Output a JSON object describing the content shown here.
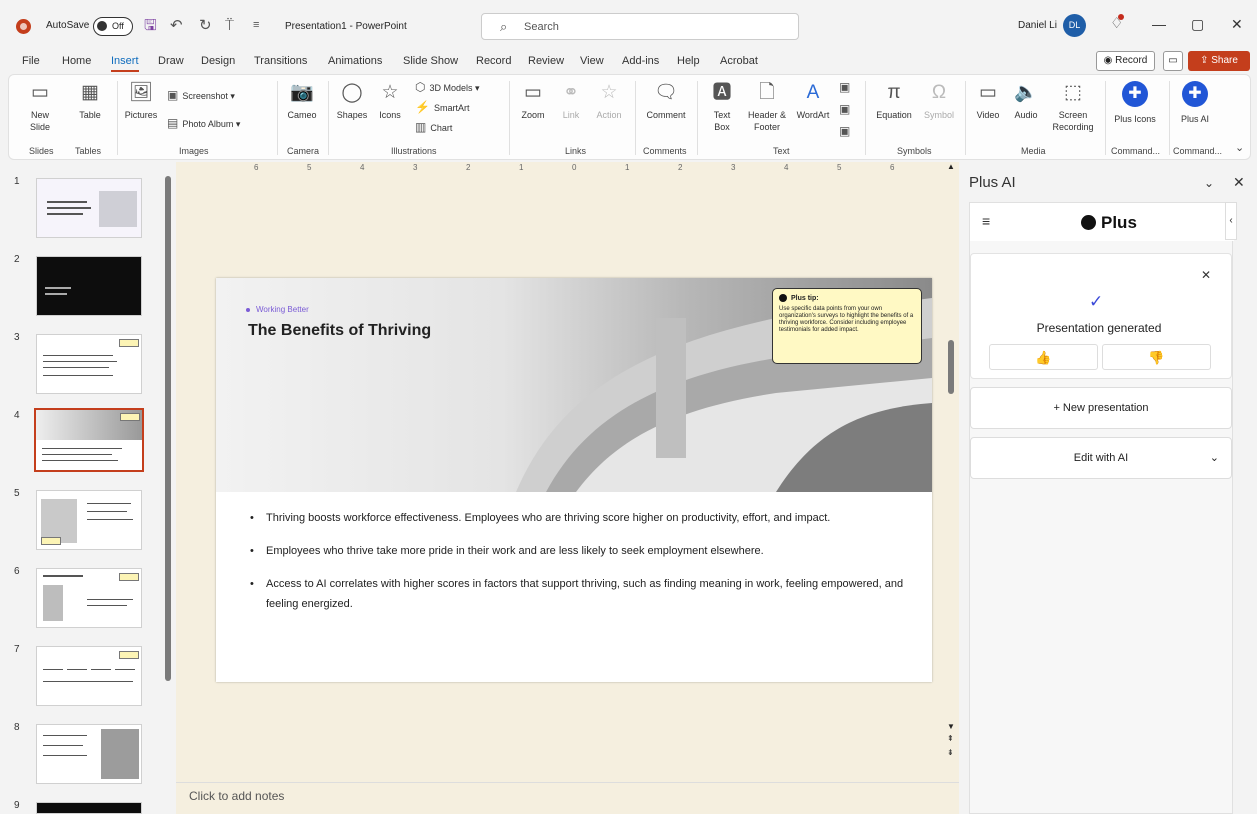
{
  "titlebar": {
    "autosave_label": "AutoSave",
    "autosave_state": "Off",
    "doc_title": "Presentation1 - PowerPoint",
    "search_placeholder": "Search",
    "user_name": "Daniel Li",
    "user_initials": "DL"
  },
  "menu": {
    "tabs": [
      "File",
      "Home",
      "Insert",
      "Draw",
      "Design",
      "Transitions",
      "Animations",
      "Slide Show",
      "Record",
      "Review",
      "View",
      "Add-ins",
      "Help",
      "Acrobat"
    ],
    "active_tab": "Insert",
    "record_label": "Record",
    "share_label": "Share"
  },
  "ribbon": {
    "new_slide": "New Slide",
    "table": "Table",
    "pictures": "Pictures",
    "screenshot": "Screenshot",
    "photo_album": "Photo Album",
    "cameo": "Cameo",
    "shapes": "Shapes",
    "icons": "Icons",
    "models3d": "3D Models",
    "smartart": "SmartArt",
    "chart": "Chart",
    "zoom": "Zoom",
    "link": "Link",
    "action": "Action",
    "comment": "Comment",
    "text_box": "Text Box",
    "header_footer": "Header & Footer",
    "wordart": "WordArt",
    "equation": "Equation",
    "symbol": "Symbol",
    "video": "Video",
    "audio": "Audio",
    "screen_recording": "Screen Recording",
    "plus_icons": "Plus Icons",
    "plus_ai": "Plus AI",
    "groups": {
      "slides": "Slides",
      "tables": "Tables",
      "images": "Images",
      "camera": "Camera",
      "illustrations": "Illustrations",
      "links": "Links",
      "comments": "Comments",
      "text": "Text",
      "symbols": "Symbols",
      "media": "Media",
      "command1": "Command...",
      "command2": "Command..."
    }
  },
  "thumbnails": [
    {
      "num": "1"
    },
    {
      "num": "2"
    },
    {
      "num": "3"
    },
    {
      "num": "4"
    },
    {
      "num": "5"
    },
    {
      "num": "6"
    },
    {
      "num": "7"
    },
    {
      "num": "8"
    },
    {
      "num": "9"
    }
  ],
  "selected_slide": 4,
  "ruler_labels": [
    "6",
    "5",
    "4",
    "3",
    "2",
    "1",
    "0",
    "1",
    "2",
    "3",
    "4",
    "5",
    "6"
  ],
  "slide": {
    "kicker": "Working Better",
    "title": "The Benefits of Thriving",
    "tip_title": "Plus tip:",
    "tip_body": "Use specific data points from your own organization's surveys to highlight the benefits of a thriving workforce. Consider including employee testimonials for added impact.",
    "bullets": [
      "Thriving boosts workforce effectiveness. Employees who are thriving score higher on productivity, effort, and impact.",
      "Employees who thrive take more pride in their work and are less likely to seek employment elsewhere.",
      "Access to AI correlates with higher scores in factors that support thriving, such as finding meaning in work, feeling empowered, and feeling energized."
    ]
  },
  "notes_placeholder": "Click to add notes",
  "panel": {
    "title": "Plus AI",
    "brand": "Plus",
    "status": "Presentation generated",
    "new_presentation": "+ New presentation",
    "edit_with_ai": "Edit with AI"
  },
  "colors": {
    "accent": "#c43e1c",
    "brand_blue": "#2156d6",
    "canvas": "#f5efdf"
  }
}
